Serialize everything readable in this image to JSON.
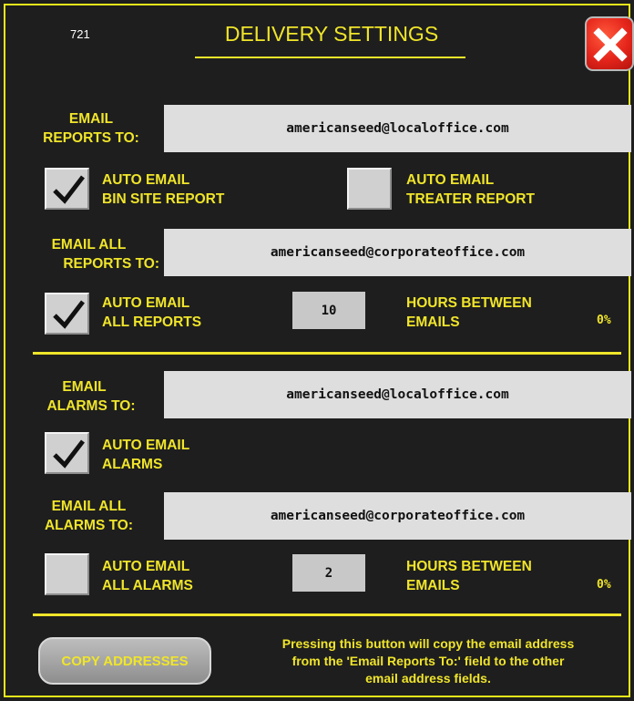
{
  "header": {
    "screen_id": "721",
    "title": "DELIVERY SETTINGS"
  },
  "reports": {
    "email_to_label_line1": "EMAIL",
    "email_to_label_line2": "REPORTS TO:",
    "email_to_value": "americanseed@localoffice.com",
    "auto_bin_site": {
      "line1": "AUTO EMAIL",
      "line2": "BIN SITE REPORT",
      "checked": true
    },
    "auto_treater": {
      "line1": "AUTO EMAIL",
      "line2": "TREATER REPORT",
      "checked": false
    },
    "email_all_label_line1": "EMAIL ALL",
    "email_all_label_line2": "REPORTS TO:",
    "email_all_value": "americanseed@corporateoffice.com",
    "auto_all": {
      "line1": "AUTO EMAIL",
      "line2": "ALL REPORTS",
      "checked": true
    },
    "hours_value": "10",
    "hours_label_line1": "HOURS BETWEEN",
    "hours_label_line2": "EMAILS",
    "percent": "0%"
  },
  "alarms": {
    "email_to_label_line1": "EMAIL",
    "email_to_label_line2": "ALARMS TO:",
    "email_to_value": "americanseed@localoffice.com",
    "auto_alarms": {
      "line1": "AUTO EMAIL",
      "line2": "ALARMS",
      "checked": true
    },
    "email_all_label_line1": "EMAIL ALL",
    "email_all_label_line2": "ALARMS TO:",
    "email_all_value": "americanseed@corporateoffice.com",
    "auto_all": {
      "line1": "AUTO EMAIL",
      "line2": "ALL ALARMS",
      "checked": false
    },
    "hours_value": "2",
    "hours_label_line1": "HOURS BETWEEN",
    "hours_label_line2": "EMAILS",
    "percent": "0%"
  },
  "footer": {
    "copy_button_label": "COPY ADDRESSES",
    "note_line1": "Pressing this button will copy the email address",
    "note_line2": "from the 'Email Reports To:' field to the other",
    "note_line3": "email address fields."
  },
  "colors": {
    "background": "#1e1e1e",
    "accent_yellow": "#f0e52a",
    "field_gray": "#dedede",
    "close_red": "#e5251b"
  },
  "icons": {
    "close": "close-x-icon",
    "check": "checkmark-icon"
  }
}
